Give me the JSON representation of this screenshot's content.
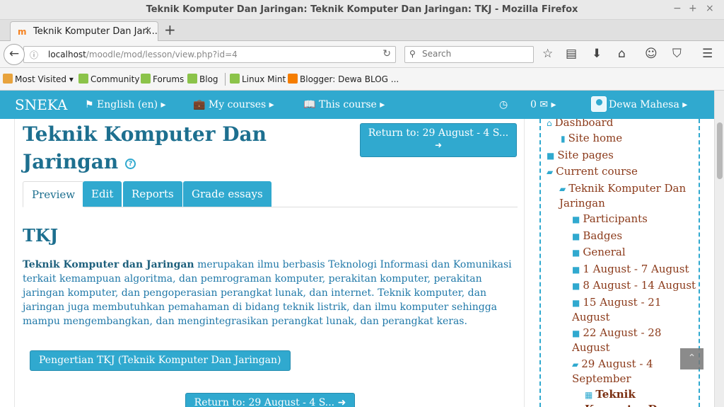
{
  "window": {
    "title": "Teknik Komputer Dan Jaringan: Teknik Komputer Dan Jaringan: TKJ - Mozilla Firefox",
    "controls": [
      "−",
      "+",
      "×"
    ]
  },
  "tab": {
    "label": "Teknik Komputer Dan Jari...",
    "close": "×",
    "new_tab": "+"
  },
  "nav": {
    "url_host": "localhost",
    "url_path": "/moodle/mod/lesson/view.php?id=4",
    "search_placeholder": "Search"
  },
  "bookmarks": [
    {
      "label": "Most Visited ▾",
      "color": "#e8a33d"
    },
    {
      "label": "Community",
      "color": "#8bc34a"
    },
    {
      "label": "Forums",
      "color": "#8bc34a"
    },
    {
      "label": "Blog",
      "color": "#8bc34a"
    },
    {
      "label": "Linux Mint",
      "color": "#8bc34a"
    },
    {
      "label": "Blogger: Dewa BLOG ...",
      "color": "#f57d00"
    }
  ],
  "moodle_nav": {
    "brand": "SNEKA",
    "language": "English (en)",
    "my_courses": "My courses",
    "this_course": "This course",
    "messages_count": "0",
    "user": "Dewa Mahesa"
  },
  "page": {
    "title": "Teknik Komputer Dan Jaringan",
    "return_label": "Return to: 29 August - 4 S...",
    "tabs": [
      "Preview",
      "Edit",
      "Reports",
      "Grade essays"
    ],
    "heading": "TKJ",
    "para_bold": "Teknik Komputer dan Jaringan",
    "para_rest": " merupakan ilmu berbasis Teknologi Informasi dan Komunikasi terkait kemampuan algoritma, dan pemrograman komputer, perakitan komputer, perakitan jaringan komputer, dan pengoperasian perangkat lunak, dan internet. Teknik komputer, dan jaringan juga membutuhkan pemahaman di bidang teknik listrik, dan ilmu komputer sehingga mampu mengembangkan, dan mengintegrasikan perangkat lunak, dan perangkat keras.",
    "page_button": "Pengertian TKJ (Teknik Komputer Dan Jaringan)",
    "return_label_bottom": "Return to: 29 August - 4 S..."
  },
  "sidebar": {
    "items": [
      {
        "label": "Dashboard",
        "icon": "home-icon"
      },
      {
        "label": "Site home",
        "icon": "file-icon"
      },
      {
        "label": "Site pages",
        "icon": "folder-icon"
      },
      {
        "label": "Current course",
        "icon": "folder-open-icon"
      },
      {
        "label": "Teknik Komputer Dan Jaringan",
        "icon": "folder-open-icon"
      },
      {
        "label": "Participants",
        "icon": "folder-icon"
      },
      {
        "label": "Badges",
        "icon": "folder-icon"
      },
      {
        "label": "General",
        "icon": "folder-icon"
      },
      {
        "label": "1 August - 7 August",
        "icon": "folder-icon"
      },
      {
        "label": "8 August - 14 August",
        "icon": "folder-icon"
      },
      {
        "label": "15 August - 21 August",
        "icon": "folder-icon"
      },
      {
        "label": "22 August - 28 August",
        "icon": "folder-icon"
      },
      {
        "label": "29 August - 4 September",
        "icon": "folder-open-icon"
      },
      {
        "label": "Teknik Komputer Dan",
        "icon": "lesson-icon"
      }
    ]
  },
  "colors": {
    "accent": "#30a9cf",
    "heading": "#1d6f8f",
    "nav_link": "#8b3a1a"
  }
}
